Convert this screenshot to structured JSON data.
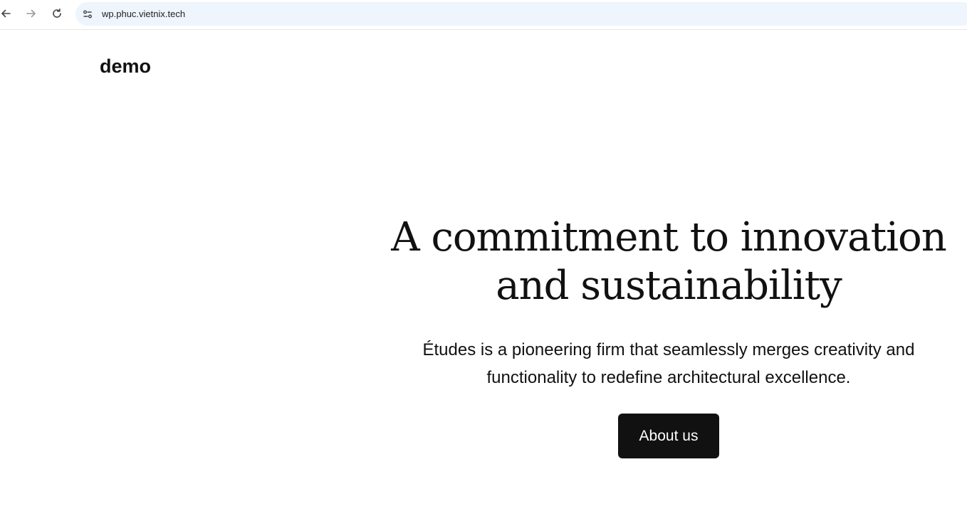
{
  "browser": {
    "url": "wp.phuc.vietnix.tech",
    "back_icon": "arrow-left-icon",
    "forward_icon": "arrow-right-icon",
    "reload_icon": "reload-icon",
    "site_info_icon": "tune-icon",
    "omnibox_color": "#eef5fc"
  },
  "site": {
    "title": "demo"
  },
  "hero": {
    "heading_line1": "A commitment to innovation",
    "heading_line2": "and sustainability",
    "subtitle": "Études is a pioneering firm that seamlessly merges creativity and functionality to redefine architectural excellence.",
    "button_label": "About us",
    "button_color": "#111111"
  }
}
